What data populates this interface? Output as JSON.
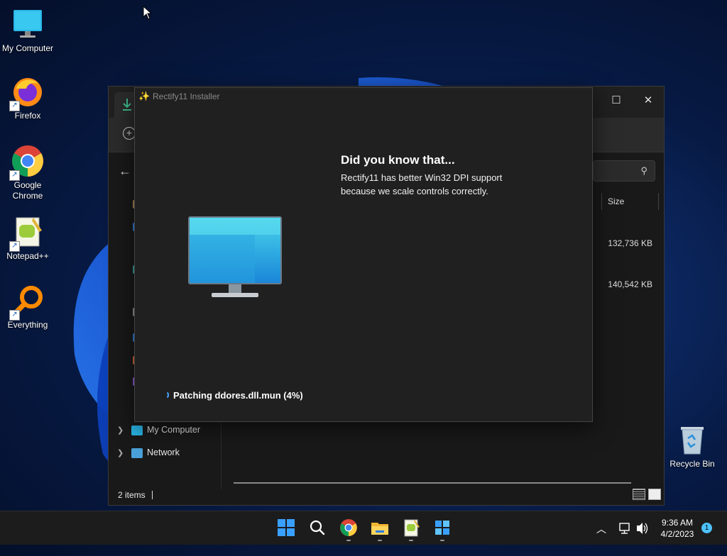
{
  "desktop": {
    "icons": [
      {
        "label": "My Computer"
      },
      {
        "label": "Firefox"
      },
      {
        "label": "Google Chrome"
      },
      {
        "label": "Notepad++"
      },
      {
        "label": "Everything"
      }
    ],
    "recycle_bin": {
      "label": "Recycle Bin"
    }
  },
  "explorer": {
    "nav": [
      {
        "label": "My Computer",
        "icon": "monitor-icon"
      },
      {
        "label": "Network",
        "icon": "network-icon"
      }
    ],
    "columns": {
      "size": "Size"
    },
    "files": [
      {
        "size": "132,736 KB"
      },
      {
        "size": "140,542 KB"
      }
    ],
    "status": {
      "items_count": "2 items"
    }
  },
  "installer": {
    "title": "Rectify11 Installer",
    "heading": "Did you know that...",
    "body_line1": "Rectify11 has better Win32 DPI support",
    "body_line2": "because we scale controls correctly.",
    "status": "Patching ddores.dll.mun (4%)",
    "progress_percent": 4
  },
  "taskbar": {
    "apps": [
      "start-icon",
      "search-icon",
      "chrome-icon",
      "file-explorer-icon",
      "notepad-plus-plus-icon",
      "rectify11-installer-icon"
    ],
    "clock": {
      "time": "9:36 AM",
      "date": "4/2/2023"
    },
    "notification_count": "1"
  },
  "colors": {
    "accent": "#4cc2ff",
    "window_bg": "#202020",
    "taskbar_bg": "#1c1c1c"
  }
}
